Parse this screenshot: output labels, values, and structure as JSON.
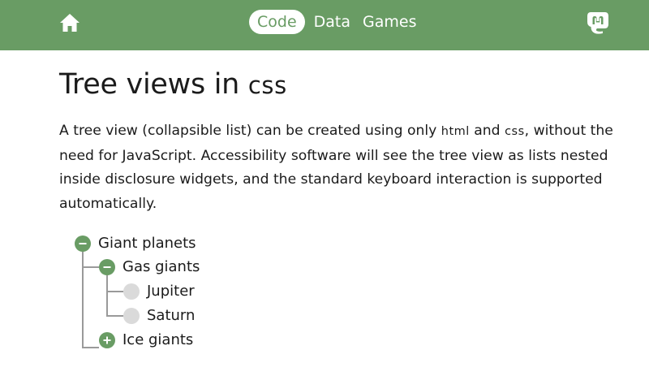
{
  "nav": {
    "home_icon": "home-icon",
    "items": [
      {
        "label": "Code",
        "active": true
      },
      {
        "label": "Data",
        "active": false
      },
      {
        "label": "Games",
        "active": false
      }
    ],
    "social_icon": "mastodon-icon"
  },
  "page": {
    "title": "Tree views in CSS",
    "title_main": "Tree views in ",
    "title_sc": "css",
    "intro": {
      "part1": "A tree view (collapsible list) can be created using only ",
      "html": "html",
      "part2": " and ",
      "css": "css",
      "part3": ", without the need for JavaScript. Accessibility software will see the tree view as lists nested inside disclosure widgets, and the standard keyboard interaction is supported automatically."
    }
  },
  "tree": {
    "root": {
      "label": "Giant planets",
      "state": "expanded"
    },
    "gas": {
      "label": "Gas giants",
      "state": "expanded"
    },
    "jupiter": {
      "label": "Jupiter",
      "state": "leaf"
    },
    "saturn": {
      "label": "Saturn",
      "state": "leaf"
    },
    "ice": {
      "label": "Ice giants",
      "state": "collapsed"
    }
  },
  "colors": {
    "accent": "#699c64",
    "leaf_marker": "#dadada",
    "text": "#1b1b1b",
    "line": "#9a9a9a"
  }
}
